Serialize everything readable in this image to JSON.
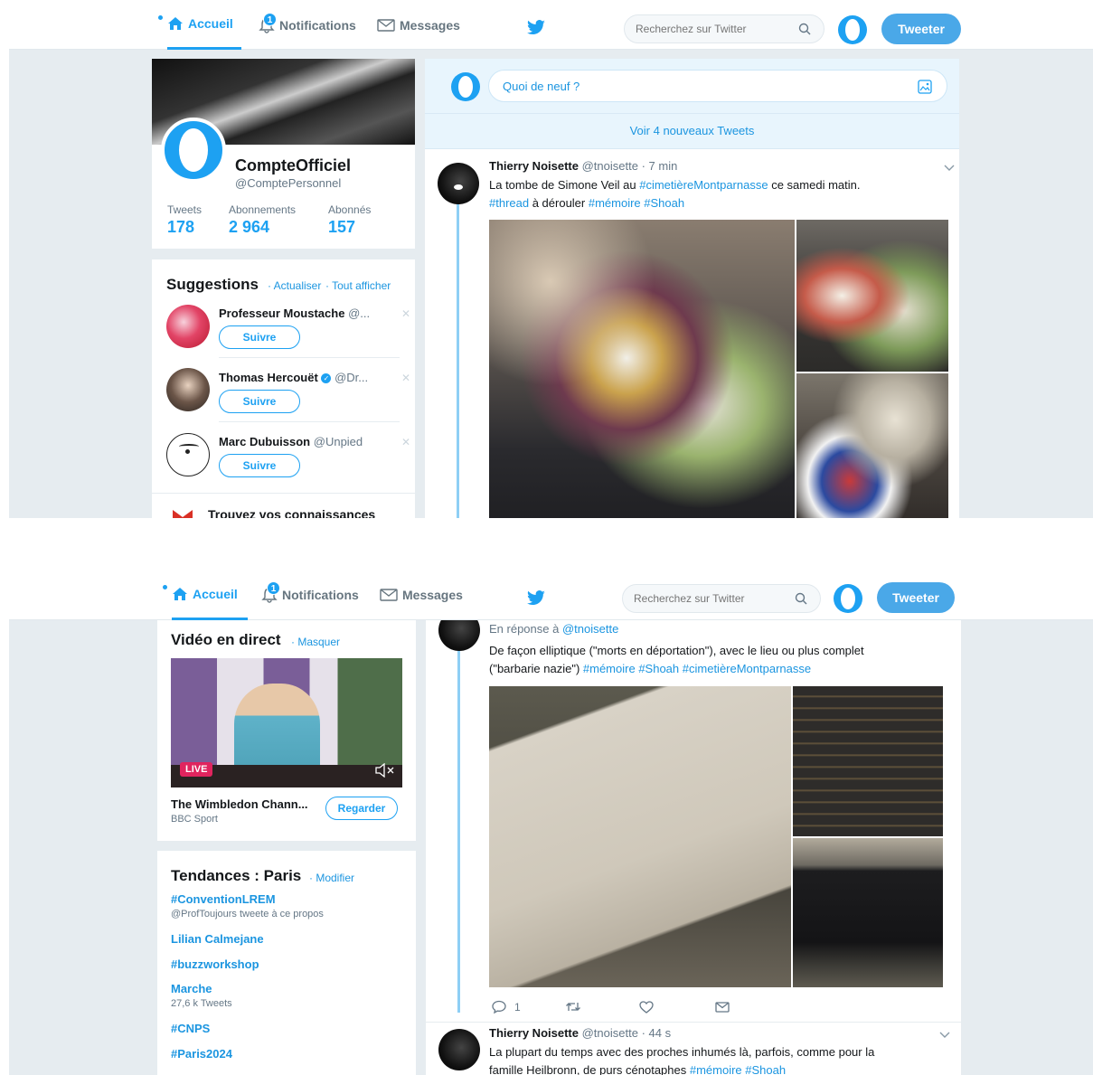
{
  "nav": {
    "home": "Accueil",
    "notifications": "Notifications",
    "notifications_badge": "1",
    "messages": "Messages",
    "search_placeholder": "Recherchez sur Twitter",
    "tweet_button": "Tweeter"
  },
  "profile": {
    "name": "CompteOfficiel",
    "handle": "@ComptePersonnel",
    "stats": [
      {
        "label": "Tweets",
        "value": "178"
      },
      {
        "label": "Abonnements",
        "value": "2 964"
      },
      {
        "label": "Abonnés",
        "value": "157"
      }
    ]
  },
  "suggestions": {
    "title": "Suggestions",
    "refresh": "· Actualiser",
    "view_all": "· Tout afficher",
    "follow_label": "Suivre",
    "items": [
      {
        "name": "Professeur Moustache",
        "handle": "@..."
      },
      {
        "name": "Thomas Hercouët",
        "handle": "@Dr..."
      },
      {
        "name": "Marc Dubuisson",
        "handle": "@Unpied"
      }
    ],
    "find_friends": "Trouvez vos connaissances"
  },
  "composer": {
    "placeholder": "Quoi de neuf ?",
    "new_tweets": "Voir 4 nouveaux Tweets"
  },
  "tweet1": {
    "author": "Thierry Noisette",
    "handle": "@tnoisette",
    "time": "· 7 min",
    "text_a": "La tombe de Simone Veil au ",
    "tag1": "#cimetièreMontparnasse",
    "text_b": " ce samedi matin.",
    "tag2": "#thread",
    "text_c": " à dérouler ",
    "tag3": "#mémoire",
    "tag4": "#Shoah"
  },
  "video": {
    "title": "Vidéo en direct",
    "hide": "· Masquer",
    "live": "LIVE",
    "channel": "The Wimbledon Chann...",
    "source": "BBC Sport",
    "watch": "Regarder"
  },
  "trends": {
    "title": "Tendances : Paris",
    "modify": "· Modifier",
    "items": [
      {
        "name": "#ConventionLREM",
        "sub": "@ProfToujours tweete à ce propos"
      },
      {
        "name": "Lilian Calmejane",
        "sub": ""
      },
      {
        "name": "#buzzworkshop",
        "sub": ""
      },
      {
        "name": "Marche",
        "sub": "27,6 k Tweets"
      },
      {
        "name": "#CNPS",
        "sub": ""
      },
      {
        "name": "#Paris2024",
        "sub": ""
      }
    ]
  },
  "tweet2": {
    "reply_prefix": "En réponse à ",
    "reply_to": "@tnoisette",
    "line1": "De façon elliptique (\"morts en déportation\"), avec le lieu ou plus complet",
    "line2_a": "(\"barbarie nazie\") ",
    "tag1": "#mémoire",
    "tag2": "#Shoah",
    "tag3": "#cimetièreMontparnasse",
    "reply_count": "1"
  },
  "tweet3": {
    "author": "Thierry Noisette",
    "handle": "@tnoisette",
    "time": "· 44 s",
    "line1": "La plupart du temps avec des proches inhumés là, parfois, comme pour la",
    "line2_a": "famille Heilbronn, de purs cénotaphes ",
    "tag1": "#mémoire",
    "tag2": "#Shoah"
  },
  "colors": {
    "accent": "#1da1f2",
    "link": "#1b95e0",
    "background": "#e6ecf0"
  }
}
